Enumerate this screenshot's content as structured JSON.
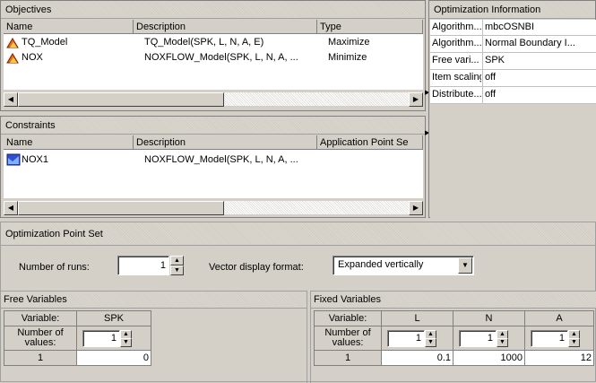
{
  "objectives": {
    "title": "Objectives",
    "columns": [
      "Name",
      "Description",
      "Type"
    ],
    "rows": [
      {
        "name": "TQ_Model",
        "description": "TQ_Model(SPK, L, N, A, E)",
        "type": "Maximize"
      },
      {
        "name": "NOX",
        "description": "NOXFLOW_Model(SPK, L, N, A, ...",
        "type": "Minimize"
      }
    ]
  },
  "constraints": {
    "title": "Constraints",
    "columns": [
      "Name",
      "Description",
      "Application Point Se"
    ],
    "rows": [
      {
        "name": "NOX1",
        "description": "NOXFLOW_Model(SPK, L, N, A, ..."
      }
    ]
  },
  "info": {
    "title": "Optimization Information",
    "rows": [
      {
        "key": "Algorithm...",
        "value": "mbcOSNBI"
      },
      {
        "key": "Algorithm...",
        "value": "Normal Boundary I..."
      },
      {
        "key": "Free vari...",
        "value": "SPK"
      },
      {
        "key": "Item scaling",
        "value": "off"
      },
      {
        "key": "Distribute...",
        "value": "off"
      }
    ]
  },
  "pointset": {
    "title": "Optimization Point Set",
    "runs_label": "Number of runs:",
    "runs_value": "1",
    "vector_label": "Vector display format:",
    "vector_value": "Expanded vertically"
  },
  "free_vars": {
    "title": "Free Variables",
    "variable_label": "Variable:",
    "numvalues_label": "Number of values:",
    "row_index": "1",
    "columns": [
      {
        "name": "SPK",
        "count": "1",
        "value": "0"
      }
    ]
  },
  "fixed_vars": {
    "title": "Fixed Variables",
    "variable_label": "Variable:",
    "numvalues_label": "Number of values:",
    "row_index": "1",
    "columns": [
      {
        "name": "L",
        "count": "1",
        "value": "0.1"
      },
      {
        "name": "N",
        "count": "1",
        "value": "1000"
      },
      {
        "name": "A",
        "count": "1",
        "value": "12"
      }
    ]
  }
}
